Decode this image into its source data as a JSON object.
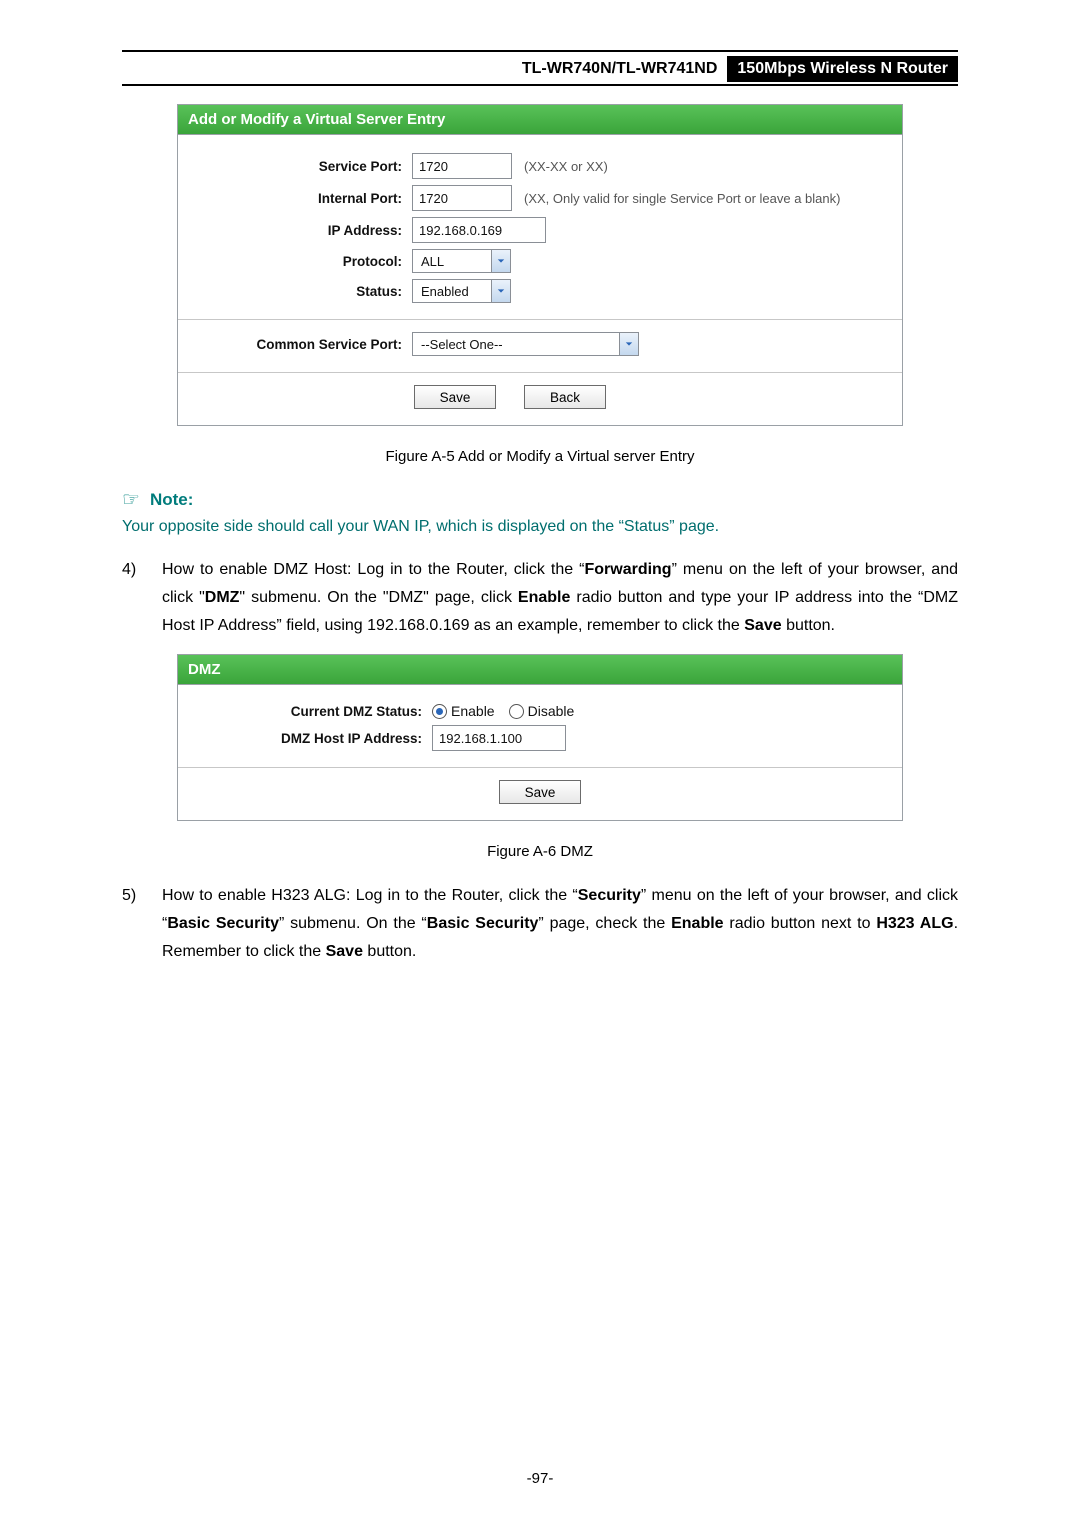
{
  "header": {
    "model": "TL-WR740N/TL-WR741ND",
    "product": "150Mbps Wireless N Router"
  },
  "figureA5": {
    "title": "Add or Modify a Virtual Server Entry",
    "labels": {
      "service_port": "Service Port:",
      "internal_port": "Internal Port:",
      "ip_address": "IP Address:",
      "protocol": "Protocol:",
      "status": "Status:",
      "common_service_port": "Common Service Port:"
    },
    "values": {
      "service_port": "1720",
      "internal_port": "1720",
      "ip_address": "192.168.0.169",
      "protocol": "ALL",
      "status": "Enabled",
      "common_service_port": "--Select One--"
    },
    "hints": {
      "service_port": "(XX-XX or XX)",
      "internal_port": "(XX, Only valid for single Service Port or leave a blank)"
    },
    "buttons": {
      "save": "Save",
      "back": "Back"
    },
    "caption": "Figure A-5    Add or Modify a Virtual server Entry"
  },
  "note": {
    "label": "Note:",
    "text": "Your opposite side should call your WAN IP, which is displayed on the “Status” page."
  },
  "item4": {
    "num": "4)",
    "pre": "How to enable DMZ Host: Log in to the Router, click the “",
    "b1": "Forwarding",
    "mid1": "” menu on the left of your browser, and click \"",
    "b2": "DMZ",
    "mid2": "\" submenu. On the \"DMZ\" page, click ",
    "b3": "Enable",
    "mid3": " radio button and type your IP address into the “DMZ Host IP Address” field, using 192.168.0.169 as an example, remember to click the ",
    "b4": "Save",
    "end": " button."
  },
  "figureA6": {
    "title": "DMZ",
    "labels": {
      "status": "Current DMZ Status:",
      "host_ip": "DMZ Host IP Address:"
    },
    "values": {
      "host_ip": "192.168.1.100"
    },
    "radios": {
      "enable": "Enable",
      "disable": "Disable"
    },
    "buttons": {
      "save": "Save"
    },
    "caption": "Figure A-6    DMZ"
  },
  "item5": {
    "num": "5)",
    "pre": "How to enable H323 ALG: Log in to the Router, click the “",
    "b1": "Security",
    "mid1": "” menu on the left of your browser, and click “",
    "b2": "Basic Security",
    "mid2": "” submenu. On the “",
    "b3": "Basic Security",
    "mid3": "” page, check the ",
    "b4": "Enable",
    "mid4": " radio button next to ",
    "b5": "H323 ALG",
    "mid5": ". Remember to click the ",
    "b6": "Save",
    "end": " button."
  },
  "page_number": "-97-"
}
